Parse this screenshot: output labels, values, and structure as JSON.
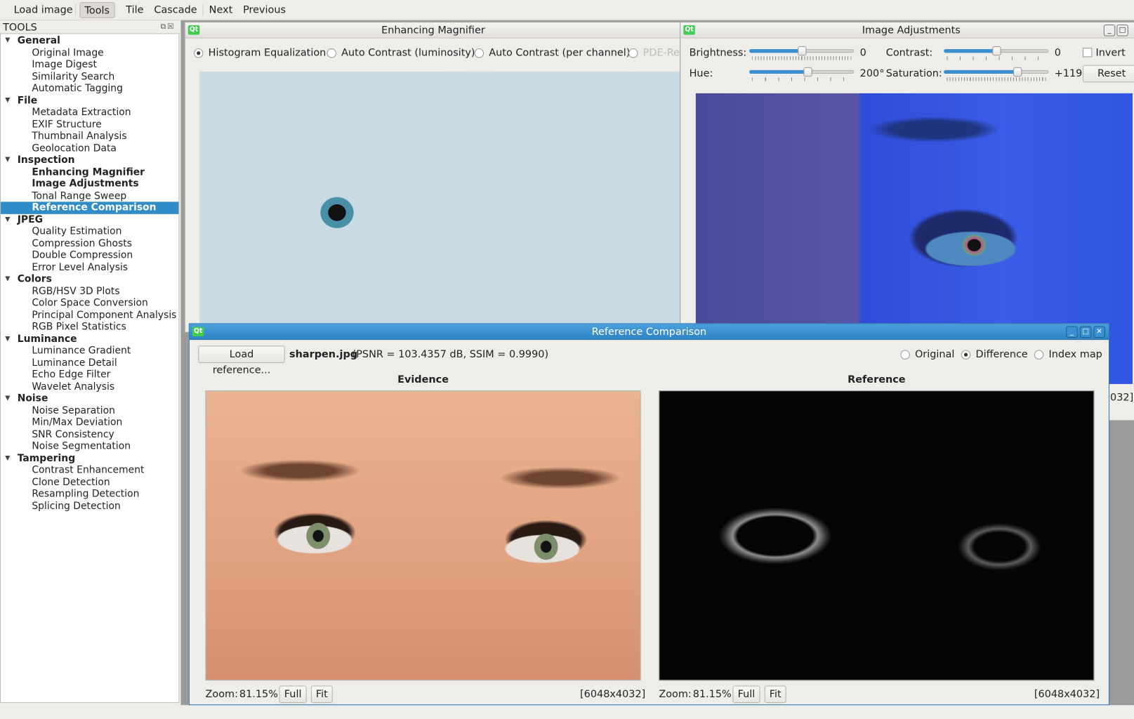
{
  "toolbar": {
    "items": [
      "Load image",
      "Tools",
      "Tile",
      "Cascade",
      "Next",
      "Previous"
    ],
    "active": "Tools"
  },
  "dock": {
    "title": "TOOLS"
  },
  "tree": [
    {
      "label": "General",
      "items": [
        "Original Image",
        "Image Digest",
        "Similarity Search",
        "Automatic Tagging"
      ]
    },
    {
      "label": "File",
      "items": [
        "Metadata Extraction",
        "EXIF Structure",
        "Thumbnail Analysis",
        "Geolocation Data"
      ]
    },
    {
      "label": "Inspection",
      "items": [
        "Enhancing Magnifier",
        "Image Adjustments",
        "Tonal Range Sweep",
        "Reference Comparison"
      ]
    },
    {
      "label": "JPEG",
      "items": [
        "Quality Estimation",
        "Compression Ghosts",
        "Double Compression",
        "Error Level Analysis"
      ]
    },
    {
      "label": "Colors",
      "items": [
        "RGB/HSV 3D Plots",
        "Color Space Conversion",
        "Principal Component Analysis",
        "RGB Pixel Statistics"
      ]
    },
    {
      "label": "Luminance",
      "items": [
        "Luminance Gradient",
        "Luminance Detail",
        "Echo Edge Filter",
        "Wavelet Analysis"
      ]
    },
    {
      "label": "Noise",
      "items": [
        "Noise Separation",
        "Min/Max Deviation",
        "SNR Consistency",
        "Noise Segmentation"
      ]
    },
    {
      "label": "Tampering",
      "items": [
        "Contrast Enhancement",
        "Clone Detection",
        "Resampling Detection",
        "Splicing Detection"
      ]
    }
  ],
  "tree_selected": "Reference Comparison",
  "tree_open": [
    "Enhancing Magnifier",
    "Image Adjustments"
  ],
  "magnifier": {
    "title": "Enhancing Magnifier",
    "options": [
      "Histogram Equalization",
      "Auto Contrast (luminosity)",
      "Auto Contrast (per channel)",
      "PDE-Retinex"
    ],
    "selected": 0,
    "disabled": [
      3
    ]
  },
  "adjust": {
    "title": "Image Adjustments",
    "brightness_label": "Brightness:",
    "brightness": "0",
    "brightness_pos": 0.5,
    "contrast_label": "Contrast:",
    "contrast": "0",
    "contrast_pos": 0.5,
    "hue_label": "Hue:",
    "hue": "200°",
    "hue_pos": 0.56,
    "saturation_label": "Saturation:",
    "saturation": "+119",
    "saturation_pos": 0.7,
    "invert_label": "Invert",
    "invert": false,
    "reset": "Reset",
    "size_fragment": "032]"
  },
  "reference": {
    "title": "Reference Comparison",
    "load_button": "Load reference...",
    "filename": "sharpen.jpg",
    "metrics": "(PSNR = 103.4357 dB, SSIM = 0.9990)",
    "views": [
      "Original",
      "Difference",
      "Index map"
    ],
    "view_selected": 1,
    "evidence": {
      "title": "Evidence",
      "zoom": "Zoom:",
      "zoom_value": "81.15%",
      "full": "Full",
      "fit": "Fit",
      "size": "[6048x4032]"
    },
    "ref": {
      "title": "Reference",
      "zoom": "Zoom:",
      "zoom_value": "81.15%",
      "full": "Full",
      "fit": "Fit",
      "size": "[6048x4032]"
    }
  },
  "colors": {
    "selection": "#308cc6",
    "titlebar_active": "#3a8fd0",
    "qt_badge": "#41cd52"
  }
}
